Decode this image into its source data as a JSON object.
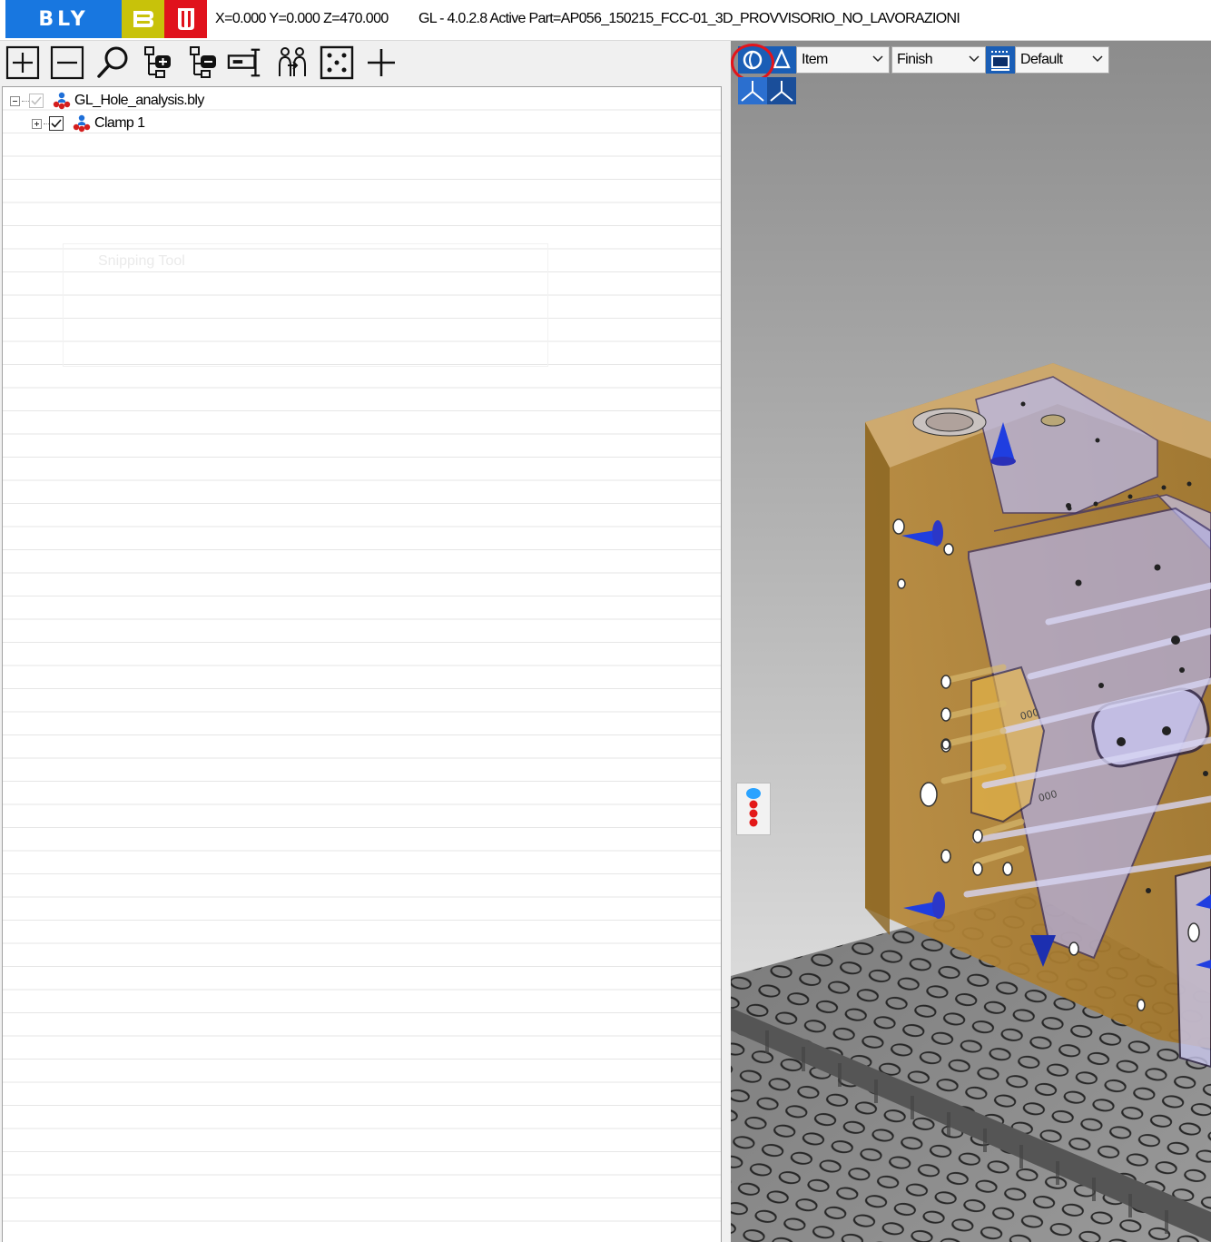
{
  "title_bar": {
    "logo_text": "BLY",
    "coordinates": "X=0.000 Y=0.000 Z=470.000",
    "version_info": "GL - 4.0.2.8 Active Part=AP056_150215_FCC-01_3D_PROVVISORIO_NO_LAVORAZIONI"
  },
  "toolbar": {
    "buttons": [
      {
        "name": "expand-all",
        "icon": "plus-box-icon"
      },
      {
        "name": "collapse-all",
        "icon": "minus-box-icon"
      },
      {
        "name": "search",
        "icon": "search-icon"
      },
      {
        "name": "tree-add",
        "icon": "tree-plus-icon"
      },
      {
        "name": "tree-remove",
        "icon": "tree-minus-icon"
      },
      {
        "name": "rename",
        "icon": "rename-cursor-icon"
      },
      {
        "name": "people",
        "icon": "people-icon"
      },
      {
        "name": "select-frame",
        "icon": "dotted-frame-icon"
      },
      {
        "name": "add",
        "icon": "plus-icon"
      }
    ]
  },
  "tree": {
    "root": {
      "label": "GL_Hole_analysis.bly",
      "checked": true,
      "expanded": true
    },
    "children": [
      {
        "label": "Clamp 1",
        "checked": true,
        "expanded": false
      }
    ],
    "ghost_overlay_text": "Snipping Tool"
  },
  "viewport_toolbar": {
    "item_select": {
      "value": "Item"
    },
    "finish_select": {
      "value": "Finish"
    },
    "style_select": {
      "value": "Default"
    }
  },
  "colors": {
    "brand_blue": "#1877e0",
    "brand_yellow": "#c8c20a",
    "brand_red": "#e0121c",
    "highlight_red": "#e3141b",
    "part_gold": "#b8893a",
    "fixture_purple": "#9e9ed8"
  }
}
